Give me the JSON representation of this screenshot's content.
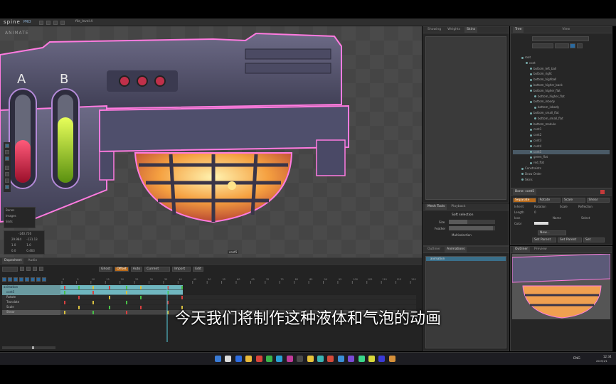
{
  "app": {
    "logo": "spine",
    "logo_suffix": "PRO",
    "file_name": "file_level.4",
    "mode_label": "ANIMATE"
  },
  "left_top_tabs": [
    "Dopesheet",
    "Audio"
  ],
  "viewport": {
    "side_panel_rows": [
      {
        "label": "Bones",
        "value": ""
      },
      {
        "label": "Images",
        "value": ""
      },
      {
        "label": "Slots",
        "value": ""
      }
    ],
    "transform_rows": [
      {
        "a": "-240.726",
        "b": ""
      },
      {
        "a": "29.984",
        "b": "-131.13"
      },
      {
        "a": "1.0",
        "b": "1.0"
      },
      {
        "a": "0.0",
        "b": "0.463"
      }
    ],
    "bone_tag": "cont5"
  },
  "skins_panel": {
    "tabs": [
      "Showing",
      "Weights",
      "Skins"
    ]
  },
  "tree_panel": {
    "title": "Tree",
    "view_label": "View",
    "items": [
      {
        "label": "root",
        "indent": 2
      },
      {
        "label": "cont",
        "indent": 3
      },
      {
        "label": "bottom_left_ball",
        "indent": 4
      },
      {
        "label": "bottom_right",
        "indent": 4
      },
      {
        "label": "bottom_highball",
        "indent": 4
      },
      {
        "label": "bottom_higher_back",
        "indent": 4
      },
      {
        "label": "bottom_higher_flat",
        "indent": 4
      },
      {
        "label": "bottom_higher_flat",
        "indent": 5
      },
      {
        "label": "bottom_inbody",
        "indent": 4
      },
      {
        "label": "bottom_inbody",
        "indent": 5
      },
      {
        "label": "bottom_small_flat",
        "indent": 4
      },
      {
        "label": "bottom_small_flat",
        "indent": 5
      },
      {
        "label": "bottom_module",
        "indent": 4
      },
      {
        "label": "cont1",
        "indent": 4
      },
      {
        "label": "cont2",
        "indent": 4
      },
      {
        "label": "cont3",
        "indent": 4
      },
      {
        "label": "cont4",
        "indent": 4
      },
      {
        "label": "cont5",
        "indent": 4
      },
      {
        "label": "green_flat",
        "indent": 4
      },
      {
        "label": "red_flat",
        "indent": 4
      },
      {
        "label": "Constraints",
        "indent": 2
      },
      {
        "label": "Draw Order",
        "indent": 2
      },
      {
        "label": "Skins",
        "indent": 2
      }
    ],
    "selected_index": 17
  },
  "bone_props": {
    "title": "Bone: cont5",
    "buttons": [
      "Separate",
      "Rotate",
      "Scale",
      "Shear"
    ],
    "rows": [
      {
        "label": "Inherit",
        "values": [
          "Rotation",
          "Scale",
          "Reflection"
        ]
      },
      {
        "label": "Length",
        "values": [
          "0"
        ]
      },
      {
        "label": "Icon",
        "values": [
          "",
          "Name",
          "Select"
        ]
      },
      {
        "label": "Color",
        "values": [
          ""
        ]
      }
    ],
    "footer_buttons": [
      "New...",
      "Set Parent",
      "Set Parent",
      "Set"
    ]
  },
  "weights_panel": {
    "tabs": [
      "Mesh Tools",
      "Playback"
    ],
    "title": "Soft selection",
    "size_label": "Size",
    "feather_label": "Feather",
    "multiselection": "Multiselection"
  },
  "animations_panel": {
    "tabs": [
      "Outliner",
      "Animations"
    ],
    "item": "animation"
  },
  "preview_panel": {
    "tabs": [
      "Outliner",
      "Preview"
    ]
  },
  "timeline": {
    "toolbar": [
      "Ghost",
      "Offset",
      "Auto",
      "Current",
      "Import",
      "Edit"
    ],
    "rows": [
      "animation",
      "cont5",
      "Rotate",
      "Translate",
      "Scale",
      "Shear"
    ],
    "ticks": [
      "0",
      "5",
      "10",
      "15",
      "20",
      "25",
      "30",
      "35",
      "40",
      "45",
      "50",
      "55",
      "60",
      "65",
      "70",
      "75",
      "80",
      "85",
      "90",
      "95",
      "100",
      "105",
      "110",
      "115",
      "120"
    ]
  },
  "subtitle": "今天我们将制作这种液体和气泡的动画",
  "taskbar": {
    "lang": "ENG",
    "time": "12:34",
    "date": "2023/1/1"
  },
  "colors": {
    "accent_orange": "#c8772a",
    "selection_blue": "#3a6f8a",
    "timeline_teal": "#6fb6bf",
    "key_red": "#d84040",
    "key_green": "#48c048",
    "key_yellow": "#d8c040"
  }
}
